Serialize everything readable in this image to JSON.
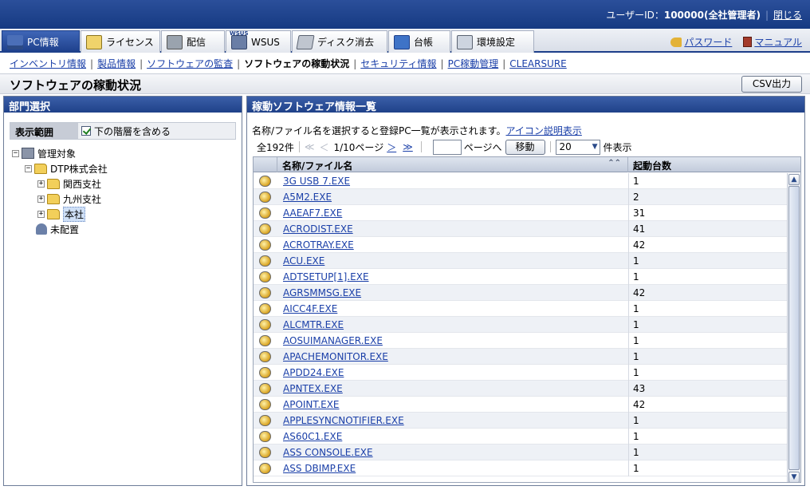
{
  "header": {
    "user_label": "ユーザーID：",
    "user_id": "100000(全社管理者)",
    "close": "閉じる"
  },
  "tabs": [
    {
      "label": "PC情報",
      "icon": "pc-icon",
      "active": true
    },
    {
      "label": "ライセンス",
      "icon": "license-icon"
    },
    {
      "label": "配信",
      "icon": "distribution-icon"
    },
    {
      "label": "WSUS",
      "icon": "wsus-icon",
      "badge": "WSUS"
    },
    {
      "label": "ディスク消去",
      "icon": "disk-erase-icon"
    },
    {
      "label": "台帳",
      "icon": "ledger-icon"
    },
    {
      "label": "環境設定",
      "icon": "settings-tools-icon"
    }
  ],
  "top_links": {
    "password": "パスワード",
    "manual": "マニュアル"
  },
  "subnav": [
    {
      "label": "インベントリ情報"
    },
    {
      "label": "製品情報"
    },
    {
      "label": "ソフトウェアの監査"
    },
    {
      "label": "ソフトウェアの稼動状況",
      "current": true
    },
    {
      "label": "セキュリティ情報"
    },
    {
      "label": "PC稼動管理"
    },
    {
      "label": "CLEARSURE"
    }
  ],
  "page": {
    "title": "ソフトウェアの稼動状況",
    "csv_button": "CSV出力"
  },
  "left_panel": {
    "title": "部門選択",
    "scope_label": "表示範囲",
    "include_sub_label": "下の階層を含める",
    "include_sub_checked": true,
    "tree": [
      {
        "label": "管理対象",
        "level": 0,
        "expander": "−",
        "icon": "building"
      },
      {
        "label": "DTP株式会社",
        "level": 1,
        "expander": "−",
        "icon": "folder"
      },
      {
        "label": "関西支社",
        "level": 2,
        "expander": "+",
        "icon": "folder"
      },
      {
        "label": "九州支社",
        "level": 2,
        "expander": "+",
        "icon": "folder"
      },
      {
        "label": "本社",
        "level": 2,
        "expander": "+",
        "icon": "folder",
        "selected": true
      },
      {
        "label": "未配置",
        "level": 1,
        "expander": "",
        "icon": "person"
      }
    ]
  },
  "right_panel": {
    "title": "稼動ソフトウェア情報一覧",
    "description": "名称/ファイル名を選択すると登録PC一覧が表示されます。",
    "icon_help_link": "アイコン説明表示",
    "pager": {
      "total": "全192件",
      "page_info": "1/10ページ",
      "goto_suffix": "ページへ",
      "move_button": "移動",
      "per_page": "20",
      "per_page_suffix": "件表示",
      "first": "≪",
      "prev": "＜",
      "next": "＞",
      "last": "≫"
    },
    "columns": {
      "name": "名称/ファイル名",
      "count": "起動台数"
    },
    "rows": [
      {
        "name": "3G USB 7.EXE",
        "count": "1"
      },
      {
        "name": "A5M2.EXE",
        "count": "2"
      },
      {
        "name": "AAEAF7.EXE",
        "count": "31"
      },
      {
        "name": "ACRODIST.EXE",
        "count": "41"
      },
      {
        "name": "ACROTRAY.EXE",
        "count": "42"
      },
      {
        "name": "ACU.EXE",
        "count": "1"
      },
      {
        "name": "ADTSETUP[1].EXE",
        "count": "1"
      },
      {
        "name": "AGRSMMSG.EXE",
        "count": "42"
      },
      {
        "name": "AICC4F.EXE",
        "count": "1"
      },
      {
        "name": "ALCMTR.EXE",
        "count": "1"
      },
      {
        "name": "AOSUIMANAGER.EXE",
        "count": "1"
      },
      {
        "name": "APACHEMONITOR.EXE",
        "count": "1"
      },
      {
        "name": "APDD24.EXE",
        "count": "1"
      },
      {
        "name": "APNTEX.EXE",
        "count": "43"
      },
      {
        "name": "APOINT.EXE",
        "count": "42"
      },
      {
        "name": "APPLESYNCNOTIFIER.EXE",
        "count": "1"
      },
      {
        "name": "AS60C1.EXE",
        "count": "1"
      },
      {
        "name": "ASS CONSOLE.EXE",
        "count": "1"
      },
      {
        "name": "ASS DBIMP.EXE",
        "count": "1"
      }
    ]
  }
}
